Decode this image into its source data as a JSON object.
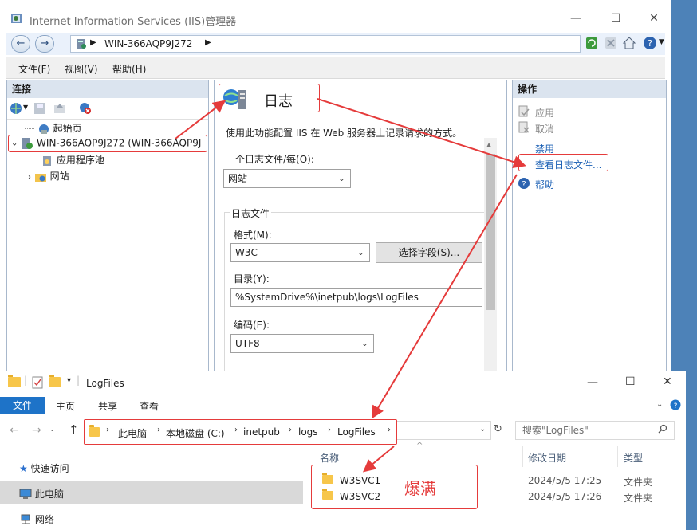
{
  "iis": {
    "title": "Internet Information Services (IIS)管理器",
    "address": "WIN-366AQP9J272",
    "menu": [
      "文件(F)",
      "视图(V)",
      "帮助(H)"
    ],
    "connections": {
      "header": "连接",
      "tree": [
        "起始页",
        "WIN-366AQP9J272 (WIN-366AQP9J",
        "应用程序池",
        "网站"
      ]
    },
    "logging": {
      "title": "日志",
      "description": "使用此功能配置 IIS 在 Web 服务器上记录请求的方式。",
      "one_log_label": "一个日志文件/每(O):",
      "one_log_value": "网站",
      "group_label": "日志文件",
      "format_label": "格式(M):",
      "format_value": "W3C",
      "select_fields_label": "选择字段(S)...",
      "directory_label": "目录(Y):",
      "directory_value": "%SystemDrive%\\inetpub\\logs\\LogFiles",
      "encoding_label": "编码(E):",
      "encoding_value": "UTF8"
    },
    "actions": {
      "header": "操作",
      "apply": "应用",
      "cancel": "取消",
      "disable": "禁用",
      "view_logs": "查看日志文件...",
      "help": "帮助"
    }
  },
  "explorer": {
    "title": "LogFiles",
    "tabs": [
      "文件",
      "主页",
      "共享",
      "查看"
    ],
    "breadcrumb": [
      "此电脑",
      "本地磁盘 (C:)",
      "inetpub",
      "logs",
      "LogFiles"
    ],
    "search_placeholder": "搜索\"LogFiles\"",
    "nav": [
      "快速访问",
      "此电脑",
      "网络"
    ],
    "columns": {
      "name": "名称",
      "modified": "修改日期",
      "type": "类型"
    },
    "files": [
      {
        "name": "W3SVC1",
        "modified": "2024/5/5 17:25",
        "type": "文件夹"
      },
      {
        "name": "W3SVC2",
        "modified": "2024/5/5 17:26",
        "type": "文件夹"
      }
    ],
    "annotation": "爆满"
  }
}
